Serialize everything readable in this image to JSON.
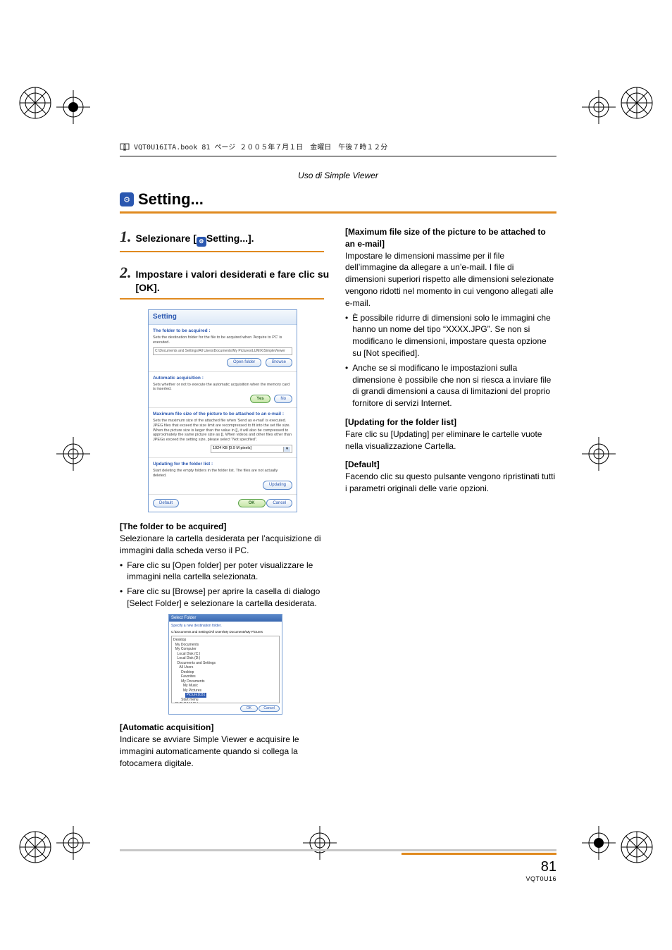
{
  "meta": {
    "header_line": "VQT0U16ITA.book  81 ページ  ２００５年７月１日　金曜日　午後７時１２分",
    "section_caption": "Uso di Simple Viewer",
    "page_number": "81",
    "doc_code": "VQT0U16"
  },
  "title": "Setting...",
  "steps": {
    "one": {
      "num": "1.",
      "text_before": "Selezionare [",
      "text_after": "Setting...]."
    },
    "two": {
      "num": "2.",
      "text": "Impostare i valori desiderati e fare clic su [OK]."
    }
  },
  "dialog": {
    "title": "Setting",
    "folder": {
      "title": "The folder to be acquired :",
      "desc": "Sets the destination folder for the file to be acquired when 'Acquire to PC' is executed.",
      "path": "C:\\Documents and Settings\\All Users\\Documents\\My Pictures\\LUMIX\\SimpleViewer",
      "open": "Open folder",
      "browse": "Browse"
    },
    "auto": {
      "title": "Automatic acquisition :",
      "desc": "Sets whether or not to execute the automatic acquisition when the memory card is inserted.",
      "yes": "Yes",
      "no": "No"
    },
    "maxsize": {
      "title": "Maximum file size of the picture to be attached to an e-mail :",
      "desc": "Sets the maximum size of the attached file when 'Send as e-mail' is executed. JPEG files that exceed the size limit are recompressed to fit into the set file size. When the picture size is larger than the value in [], it will also be compressed to approximately the same picture size as []. When videos and other files other than JPEGs exceed the setting size, please select “Not specified”.",
      "value": "1024 KB [0.9 M pixels]"
    },
    "updating": {
      "title": "Updating for the folder list :",
      "desc": "Start deleting the empty folders in the folder list. The files are not actually deleted.",
      "btn": "Updating"
    },
    "buttons": {
      "default": "Default",
      "ok": "OK",
      "cancel": "Cancel"
    }
  },
  "left": {
    "h_folder": "[The folder to be acquired]",
    "p_folder": "Selezionare la cartella desiderata per l’acquisizione di immagini dalla scheda verso il PC.",
    "b_open": "Fare clic su [Open folder] per poter visualizzare le immagini nella cartella selezionata.",
    "b_browse": "Fare clic su [Browse] per aprire la casella di dialogo [Select Folder] e selezionare la cartella desiderata.",
    "h_auto": "[Automatic acquisition]",
    "p_auto": "Indicare se avviare Simple Viewer e acquisire le immagini automaticamente quando si collega la fotocamera digitale."
  },
  "right": {
    "h_max": "[Maximum file size of the picture to be attached to an e-mail]",
    "p_max": "Impostare le dimensioni massime per il file dell’immagine da allegare a un’e-mail. I file di dimensioni superiori rispetto alle dimensioni selezionate vengono ridotti nel momento in cui vengono allegati alle e-mail.",
    "b_max1": "È possibile ridurre di dimensioni solo le immagini che hanno un nome del tipo “XXXX.JPG”. Se non si modificano le dimensioni, impostare questa opzione su [Not specified].",
    "b_max2": "Anche se si modificano le impostazioni sulla dimensione è possibile che non si riesca a inviare file di grandi dimensioni a causa di limitazioni del proprio fornitore di servizi Internet.",
    "h_upd": "[Updating for the folder list]",
    "p_upd": "Fare clic su [Updating] per eliminare le cartelle vuote nella visualizzazione Cartella.",
    "h_def": "[Default]",
    "p_def": "Facendo clic su questo pulsante vengono ripristinati tutti i parametri originali delle varie opzioni."
  },
  "select_folder": {
    "title": "Select Folder",
    "label": "Specify a new destination folder.",
    "path": "C:\\Documents and Settings\\All Users\\My Documents\\My Pictures",
    "tree": [
      "Desktop",
      "  My Documents",
      "  My Computer",
      "    Local Disk (C:)",
      "    Local Disk (D:)",
      "    Documents and Settings",
      "      All Users",
      "        Desktop",
      "        Favorites",
      "        My Documents",
      "          My Music",
      "          My Pictures"
    ],
    "highlight": "Picture1031",
    "rest": [
      "        Start menu",
      "  DVD-RAM (E:)"
    ],
    "ok": "OK",
    "cancel": "Cancel"
  }
}
